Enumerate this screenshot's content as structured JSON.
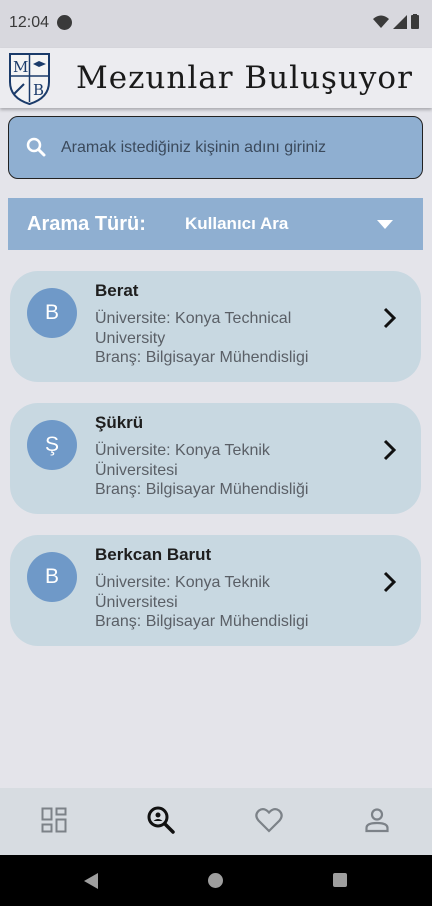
{
  "status_bar": {
    "time": "12:04"
  },
  "app_bar": {
    "logo_letters": [
      "M",
      "B"
    ],
    "title": "Mezunlar Buluşuyor"
  },
  "search": {
    "placeholder": "Aramak istediğiniz kişinin adını giriniz"
  },
  "search_type": {
    "label": "Arama Türü:",
    "selected": "Kullanıcı Ara"
  },
  "results": [
    {
      "initial": "B",
      "name": "Berat",
      "university": "Üniversite: Konya Technical University",
      "branch": "Branş: Bilgisayar Mühendisligi"
    },
    {
      "initial": "Ş",
      "name": "Şükrü",
      "university": "Üniversite: Konya Teknik Üniversitesi",
      "branch": "Branş: Bilgisayar Mühendisliği"
    },
    {
      "initial": "B",
      "name": "Berkcan Barut",
      "university": "Üniversite: Konya Teknik Üniversitesi",
      "branch": "Branş: Bilgisayar Mühendisligi"
    }
  ],
  "bottom_nav": [
    {
      "icon": "dashboard-icon",
      "active": false
    },
    {
      "icon": "search-person-icon",
      "active": true
    },
    {
      "icon": "heart-icon",
      "active": false
    },
    {
      "icon": "profile-icon",
      "active": false
    }
  ],
  "colors": {
    "accent": "#8fafd1",
    "card": "#c8d8e1",
    "avatar": "#6f99c8"
  }
}
